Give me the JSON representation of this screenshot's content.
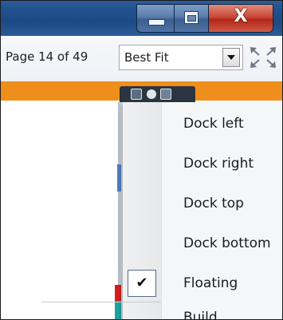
{
  "window": {
    "minimize_label": "",
    "maximize_label": "",
    "close_label": "X"
  },
  "toolbar": {
    "page_indicator": "Page 14 of 49",
    "zoom_select_value": "Best Fit"
  },
  "context_menu": {
    "items": [
      {
        "label": "Dock left",
        "checked": false
      },
      {
        "label": "Dock right",
        "checked": false
      },
      {
        "label": "Dock top",
        "checked": false
      },
      {
        "label": "Dock bottom",
        "checked": false
      },
      {
        "label": "Floating",
        "checked": true
      }
    ],
    "checkmark": "✔",
    "partial_item": "Build..."
  },
  "colors": {
    "titlebar": "#1f4f8c",
    "orange_strip": "#f08e1c",
    "menu_background": "#f5f6f7"
  },
  "icons": {
    "fullscreen": "fullscreen-arrows-icon",
    "dropdown": "chevron-down-icon",
    "pin": "pin-icon"
  }
}
